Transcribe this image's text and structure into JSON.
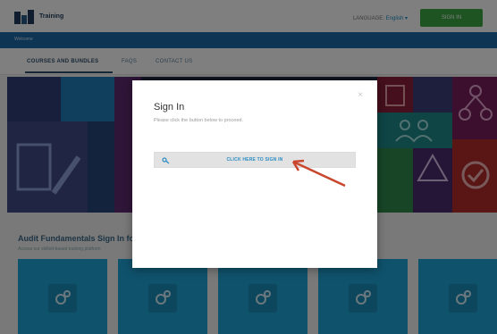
{
  "header": {
    "logo_line1": "Training",
    "logo_line2": "",
    "language_label": "LANGUAGE:",
    "language_value": "English ▾",
    "signin_label": "SIGN IN"
  },
  "bluebar": {
    "text": "Welcome"
  },
  "nav": {
    "items": [
      {
        "label": "COURSES AND BUNDLES"
      },
      {
        "label": "FAQS"
      },
      {
        "label": "CONTACT US"
      }
    ]
  },
  "section": {
    "title": "Audit Fundamentals Sign In fo",
    "subtitle": "Access our skilled-based training platform"
  },
  "modal": {
    "title": "Sign In",
    "description": "Please click the button below to proceed.",
    "button_label": "CLICK HERE TO SIGN IN",
    "close_glyph": "×"
  },
  "icons": {
    "key": "key-icon",
    "close": "close-icon",
    "gear": "gears-icon",
    "arrow": "red-arrow"
  },
  "colors": {
    "header_green": "#3aa845",
    "bluebar": "#1d6aa7",
    "card_blue": "#1fa5d8",
    "button_text": "#2a8cc4",
    "arrow_red": "#c9452c"
  }
}
